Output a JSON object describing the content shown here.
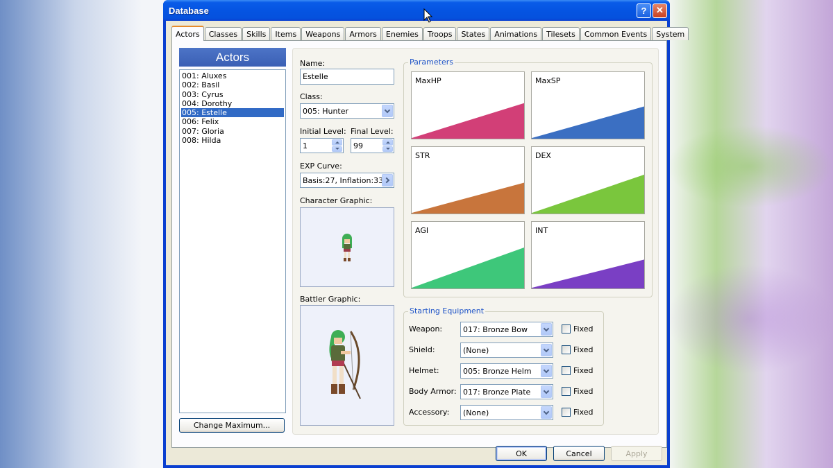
{
  "window": {
    "title": "Database",
    "help_label": "?",
    "close_label": "✕"
  },
  "tabs": [
    "Actors",
    "Classes",
    "Skills",
    "Items",
    "Weapons",
    "Armors",
    "Enemies",
    "Troops",
    "States",
    "Animations",
    "Tilesets",
    "Common Events",
    "System"
  ],
  "actors": {
    "header": "Actors",
    "items": [
      "001: Aluxes",
      "002: Basil",
      "003: Cyrus",
      "004: Dorothy",
      "005: Estelle",
      "006: Felix",
      "007: Gloria",
      "008: Hilda"
    ],
    "selected_index": 4,
    "change_maximum_label": "Change Maximum..."
  },
  "form": {
    "name_label": "Name:",
    "name_value": "Estelle",
    "class_label": "Class:",
    "class_value": "005: Hunter",
    "initial_level_label": "Initial Level:",
    "initial_level_value": "1",
    "final_level_label": "Final Level:",
    "final_level_value": "99",
    "exp_curve_label": "EXP Curve:",
    "exp_curve_value": "Basis:27, Inflation:33",
    "character_graphic_label": "Character Graphic:",
    "battler_graphic_label": "Battler Graphic:"
  },
  "parameters": {
    "title": "Parameters",
    "items": [
      {
        "name": "MaxHP",
        "color": "#d23f77",
        "start": 0.03,
        "end": 0.55
      },
      {
        "name": "MaxSP",
        "color": "#3b6fc2",
        "start": 0.03,
        "end": 0.5
      },
      {
        "name": "STR",
        "color": "#c8753c",
        "start": 0.03,
        "end": 0.48
      },
      {
        "name": "DEX",
        "color": "#7ac63d",
        "start": 0.03,
        "end": 0.6
      },
      {
        "name": "AGI",
        "color": "#3ec77a",
        "start": 0.03,
        "end": 0.63
      },
      {
        "name": "INT",
        "color": "#7a3fc4",
        "start": 0.03,
        "end": 0.45
      }
    ]
  },
  "equipment": {
    "title": "Starting Equipment",
    "fixed_label": "Fixed",
    "items": [
      {
        "label": "Weapon:",
        "value": "017: Bronze Bow"
      },
      {
        "label": "Shield:",
        "value": "(None)"
      },
      {
        "label": "Helmet:",
        "value": "005: Bronze Helm"
      },
      {
        "label": "Body Armor:",
        "value": "017: Bronze Plate"
      },
      {
        "label": "Accessory:",
        "value": "(None)"
      }
    ]
  },
  "buttons": {
    "ok": "OK",
    "cancel": "Cancel",
    "apply": "Apply"
  }
}
